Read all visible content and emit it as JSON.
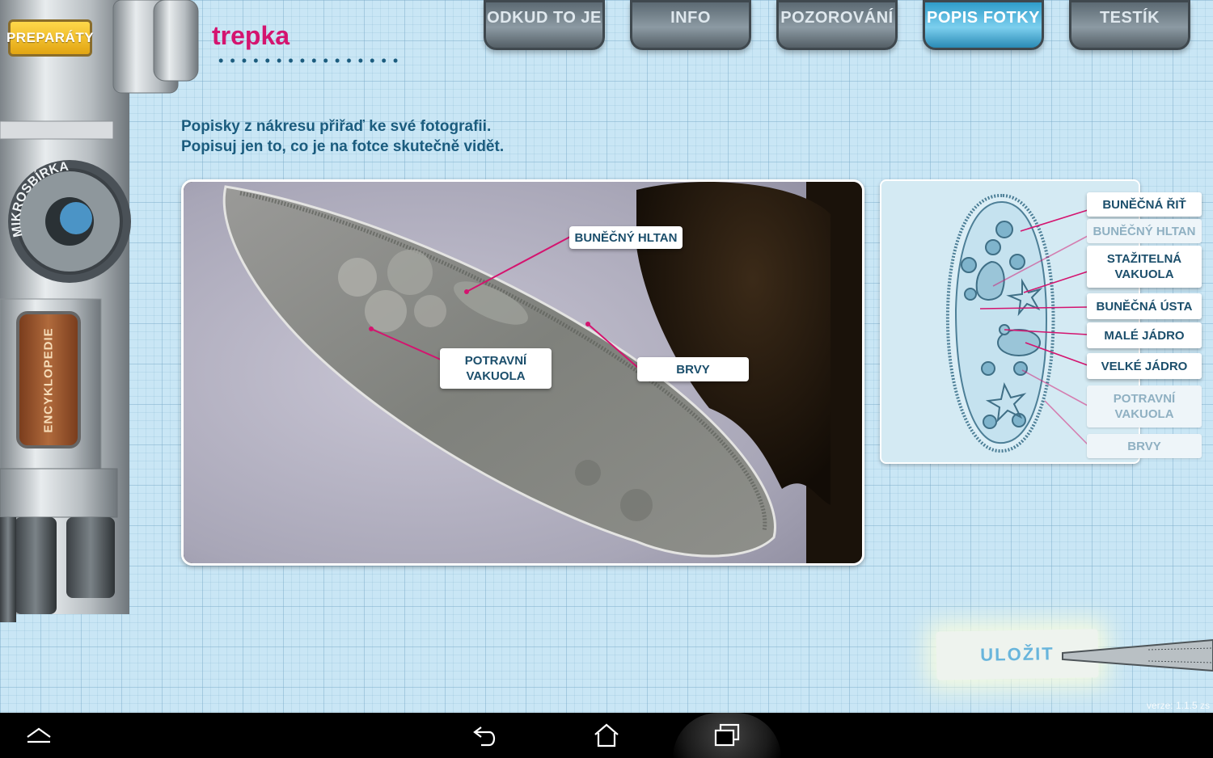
{
  "sidebar": {
    "preparaty_label": "PREPARÁTY",
    "mikrosbirka_label": "MIKROSBÍRKA",
    "encyklopedie_label": "ENCYKLOPEDIE"
  },
  "page_title": "trepka",
  "tabs": [
    {
      "label": "ODKUD TO JE",
      "active": false
    },
    {
      "label": "INFO",
      "active": false
    },
    {
      "label": "POZOROVÁNÍ",
      "active": false
    },
    {
      "label": "POPIS FOTKY",
      "active": true
    },
    {
      "label": "TESTÍK",
      "active": false
    }
  ],
  "instructions": {
    "line1": "Popisky z nákresu přiřaď ke své fotografii.",
    "line2": "Popisuj jen to, co je na fotce skutečně vidět."
  },
  "photo_labels": {
    "bunecny_hltan": "BUNĚČNÝ HLTAN",
    "potravni_vakuola": "POTRAVNÍ VAKUOLA",
    "brvy": "BRVY"
  },
  "drawing_labels": [
    {
      "label": "BUNĚČNÁ ŘIŤ",
      "used": false
    },
    {
      "label": "BUNĚČNÝ HLTAN",
      "used": true
    },
    {
      "label": "STAŽITELNÁ VAKUOLA",
      "used": false
    },
    {
      "label": "BUNĚČNÁ ÚSTA",
      "used": false
    },
    {
      "label": "MALÉ JÁDRO",
      "used": false
    },
    {
      "label": "VELKÉ JÁDRO",
      "used": false
    },
    {
      "label": "POTRAVNÍ VAKUOLA",
      "used": true
    },
    {
      "label": "BRVY",
      "used": true
    }
  ],
  "save_label": "ULOŽIT",
  "version": "verze: 1.1.5 zs",
  "navbar": {
    "icons": [
      "up-chevron-icon",
      "back-icon",
      "home-icon",
      "recent-apps-icon"
    ]
  },
  "colors": {
    "title": "#d4146f",
    "text": "#1b5c7e",
    "active_tab": "#4fb4dc"
  }
}
